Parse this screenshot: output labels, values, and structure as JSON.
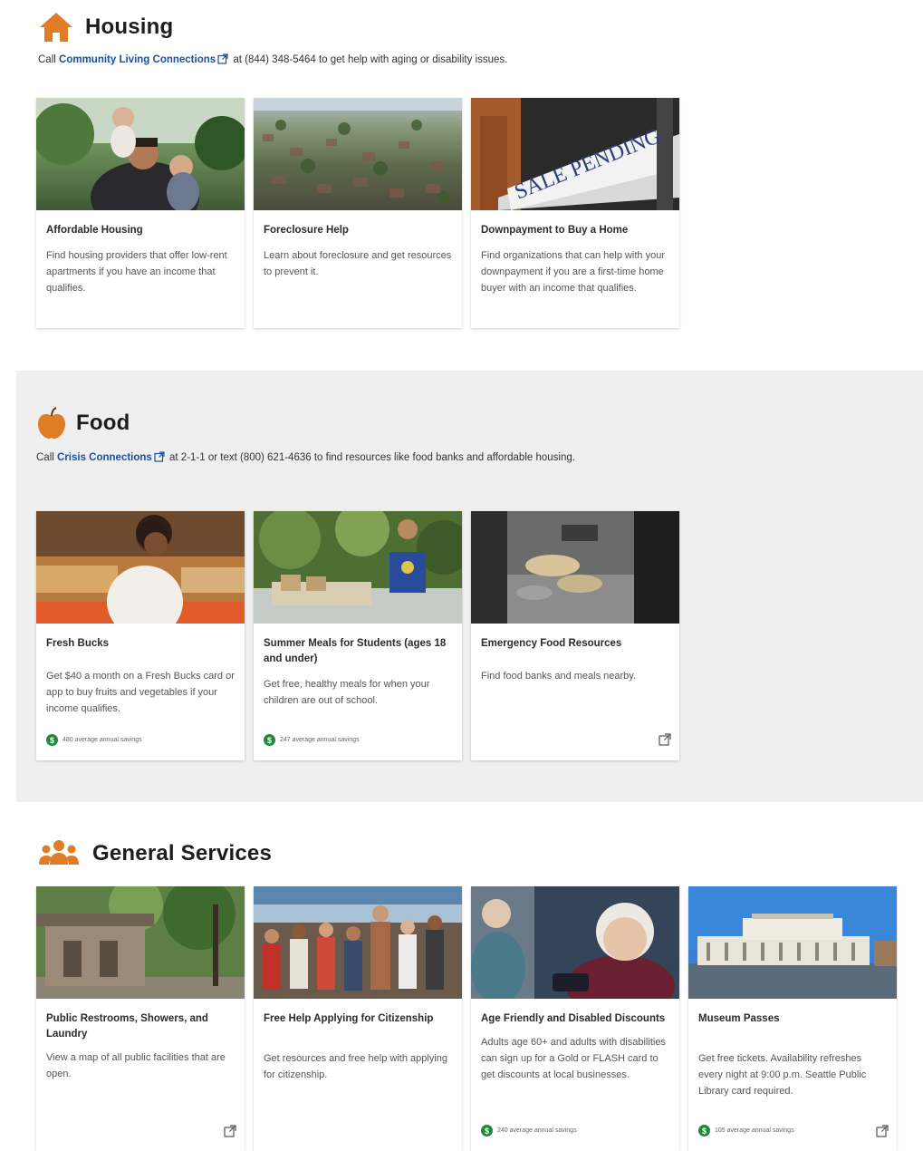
{
  "housing": {
    "title": "Housing",
    "intro_pre": "Call ",
    "intro_link": "Community Living Connections",
    "intro_post": " at (844) 348-5464 to get help with aging or disability issues.",
    "cards": [
      {
        "title": "Affordable Housing",
        "desc": "Find housing providers that offer low-rent apartments if you have an income that qualifies."
      },
      {
        "title": "Foreclosure Help",
        "desc": "Learn about foreclosure and get resources to prevent it."
      },
      {
        "title": "Downpayment to Buy a Home",
        "desc": "Find organizations that can help with your downpayment if you are a first-time home buyer with an income that qualifies.",
        "sign": "SALE PENDING"
      }
    ]
  },
  "food": {
    "title": "Food",
    "intro_pre": "Call ",
    "intro_link": "Crisis Connections",
    "intro_post": " at 2-1-1 or text (800) 621-4636 to find resources like food banks and affordable housing.",
    "cards": [
      {
        "title": "Fresh Bucks",
        "desc": "Get $40 a month on a Fresh Bucks card or app to buy fruits and vegetables if your income qualifies.",
        "savings": "480 average annual savings"
      },
      {
        "title": "Summer Meals for Students (ages 18 and under)",
        "desc": "Get free, healthy meals for when your children are out of school.",
        "savings": "247 average annual savings"
      },
      {
        "title": "Emergency Food Resources",
        "desc": "Find food banks and meals nearby."
      }
    ]
  },
  "general": {
    "title": "General Services",
    "cards": [
      {
        "title": "Public Restrooms, Showers, and Laundry",
        "desc": "View a map of all public facilities that are open."
      },
      {
        "title": "Free Help Applying for Citizenship",
        "desc": "Get resources and free help with applying for citizenship."
      },
      {
        "title": "Age Friendly and Disabled Discounts",
        "desc": "Adults age 60+ and adults with disabilities can sign up for a Gold or FLASH card to get discounts at local businesses.",
        "savings": "240 average annual savings"
      },
      {
        "title": "Museum Passes",
        "desc": "Get free tickets. Availability refreshes every night at 9:00 p.m. Seattle Public Library card required.",
        "savings": "105 average annual savings"
      }
    ]
  },
  "icons": {
    "housing": "house-icon",
    "food": "apple-icon",
    "general": "people-group-icon",
    "external": "external-link-icon",
    "savings": "dollar-badge-icon"
  },
  "colors": {
    "accent_orange": "#e07b26",
    "link_blue": "#1b4f9c",
    "savings_green": "#1d8a3f",
    "section_gray": "#efefef"
  },
  "savings_symbol": "$"
}
